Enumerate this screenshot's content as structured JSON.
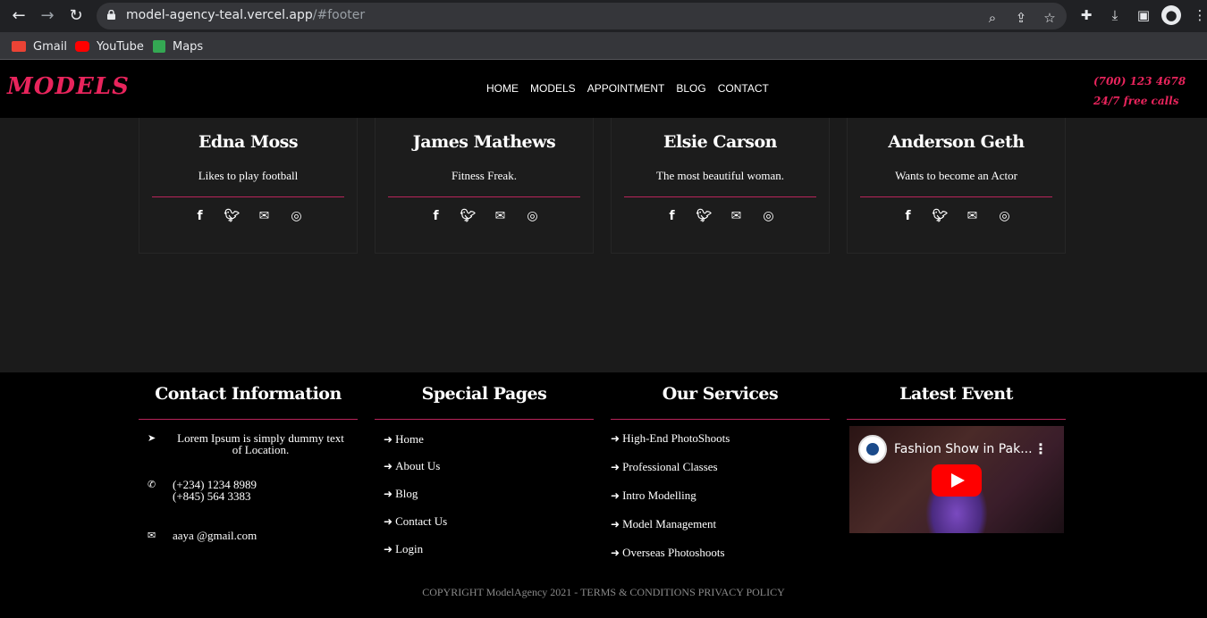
{
  "browser": {
    "url_host": "model-agency-teal.vercel.app",
    "url_path": "/#footer",
    "bookmarks": [
      {
        "label": "Gmail",
        "color": "#ea4335"
      },
      {
        "label": "YouTube",
        "color": "#ff0000"
      },
      {
        "label": "Maps",
        "color": "#34a853"
      }
    ]
  },
  "header": {
    "logo": "MODELS",
    "nav": [
      "HOME",
      "MODELS",
      "APPOINTMENT",
      "BLOG",
      "CONTACT"
    ],
    "phone": "(700) 123 4678",
    "phone_note": "24/7 free calls"
  },
  "team": [
    {
      "name": "Edna Moss",
      "desc": "Likes to play football"
    },
    {
      "name": "James Mathews",
      "desc": "Fitness Freak."
    },
    {
      "name": "Elsie Carson",
      "desc": "The most beautiful woman."
    },
    {
      "name": "Anderson Geth",
      "desc": "Wants to become an Actor"
    }
  ],
  "footer": {
    "contact": {
      "heading": "Contact Information",
      "location": "Lorem Ipsum is simply dummy text of Location.",
      "phone1": "(+234) 1234 8989",
      "phone2": "(+845) 564 3383",
      "email": "aaya @gmail.com"
    },
    "pages": {
      "heading": "Special Pages",
      "links": [
        "Home",
        "About Us",
        "Blog",
        "Contact Us",
        "Login"
      ]
    },
    "services": {
      "heading": "Our Services",
      "links": [
        "High-End PhotoShoots",
        "Professional Classes",
        "Intro Modelling",
        "Model Management",
        "Overseas Photoshoots"
      ]
    },
    "event": {
      "heading": "Latest Event",
      "video_title": "Fashion Show in Pak..."
    },
    "copyright": "COPYRIGHT ModelAgency 2021 - TERMS & CONDITIONS PRIVACY POLICY"
  },
  "colors": {
    "accent": "#e8245c",
    "rule": "#b8245a"
  }
}
